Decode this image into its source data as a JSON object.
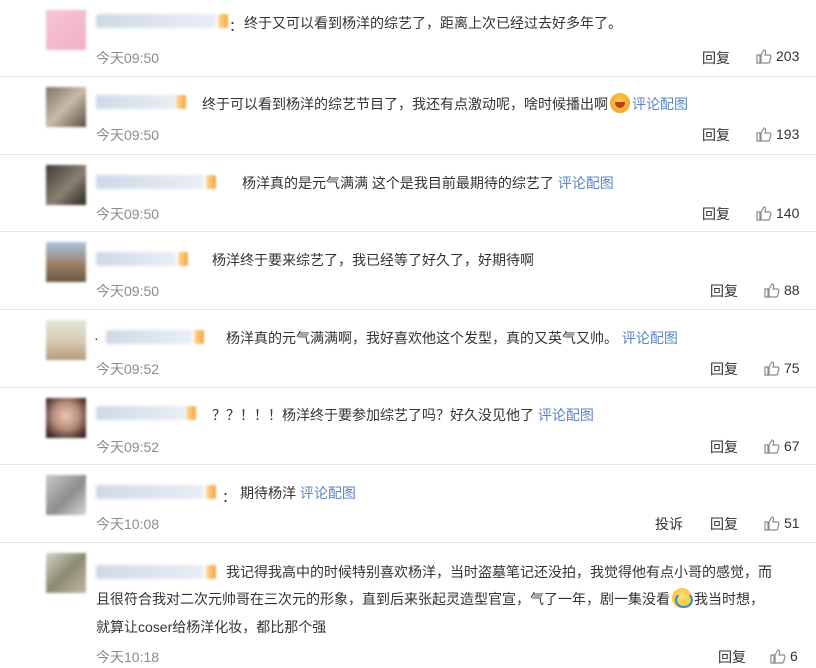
{
  "comments": [
    {
      "text": "终于又可以看到杨洋的综艺了，距离上次已经过去好多年了。",
      "time": "今天09:50",
      "reply": "回复",
      "likes": "203",
      "colon": "："
    },
    {
      "text": "终于可以看到杨洋的综艺节目了，我还有点激动呢，啥时候播出啊",
      "emoji": "cry-face",
      "link": "评论配图",
      "time": "今天09:50",
      "reply": "回复",
      "likes": "193"
    },
    {
      "text": "杨洋真的是元气满满 这个是我目前最期待的综艺了",
      "link": "评论配图",
      "time": "今天09:50",
      "reply": "回复",
      "likes": "140"
    },
    {
      "text": "杨洋终于要来综艺了，我已经等了好久了，好期待啊",
      "time": "今天09:50",
      "reply": "回复",
      "likes": "88"
    },
    {
      "text": "杨洋真的元气满满啊，我好喜欢他这个发型，真的又英气又帅。",
      "link": "评论配图",
      "time": "今天09:52",
      "reply": "回复",
      "likes": "75",
      "dot": "·"
    },
    {
      "text": "？？！！！杨洋终于要参加综艺了吗？好久没见他了",
      "link": "评论配图",
      "time": "今天09:52",
      "reply": "回复",
      "likes": "67"
    },
    {
      "text": "期待杨洋",
      "link": "评论配图",
      "time": "今天10:08",
      "report": "投诉",
      "reply": "回复",
      "likes": "51",
      "colon": "："
    },
    {
      "line1": "我记得我高中的时候特别喜欢杨洋，当时盗墓笔记还没拍，我觉得他有点小哥的感觉，而",
      "line2a": "且很符合我对二次元帅哥在三次元的形象，直到后来张起灵造型官宣，气了一年，剧一集没看",
      "emoji": "laugh-cry-face",
      "line2b": "我当时想，",
      "line3": "就算让coser给杨洋化妆，都比那个强",
      "time": "今天10:18",
      "reply": "回复",
      "likes": "6"
    }
  ],
  "icons": {
    "like": "thumbs-up-icon"
  },
  "colors": {
    "link": "#5a84c4",
    "time": "#8c8c8c",
    "divider": "#e6e6e6"
  }
}
